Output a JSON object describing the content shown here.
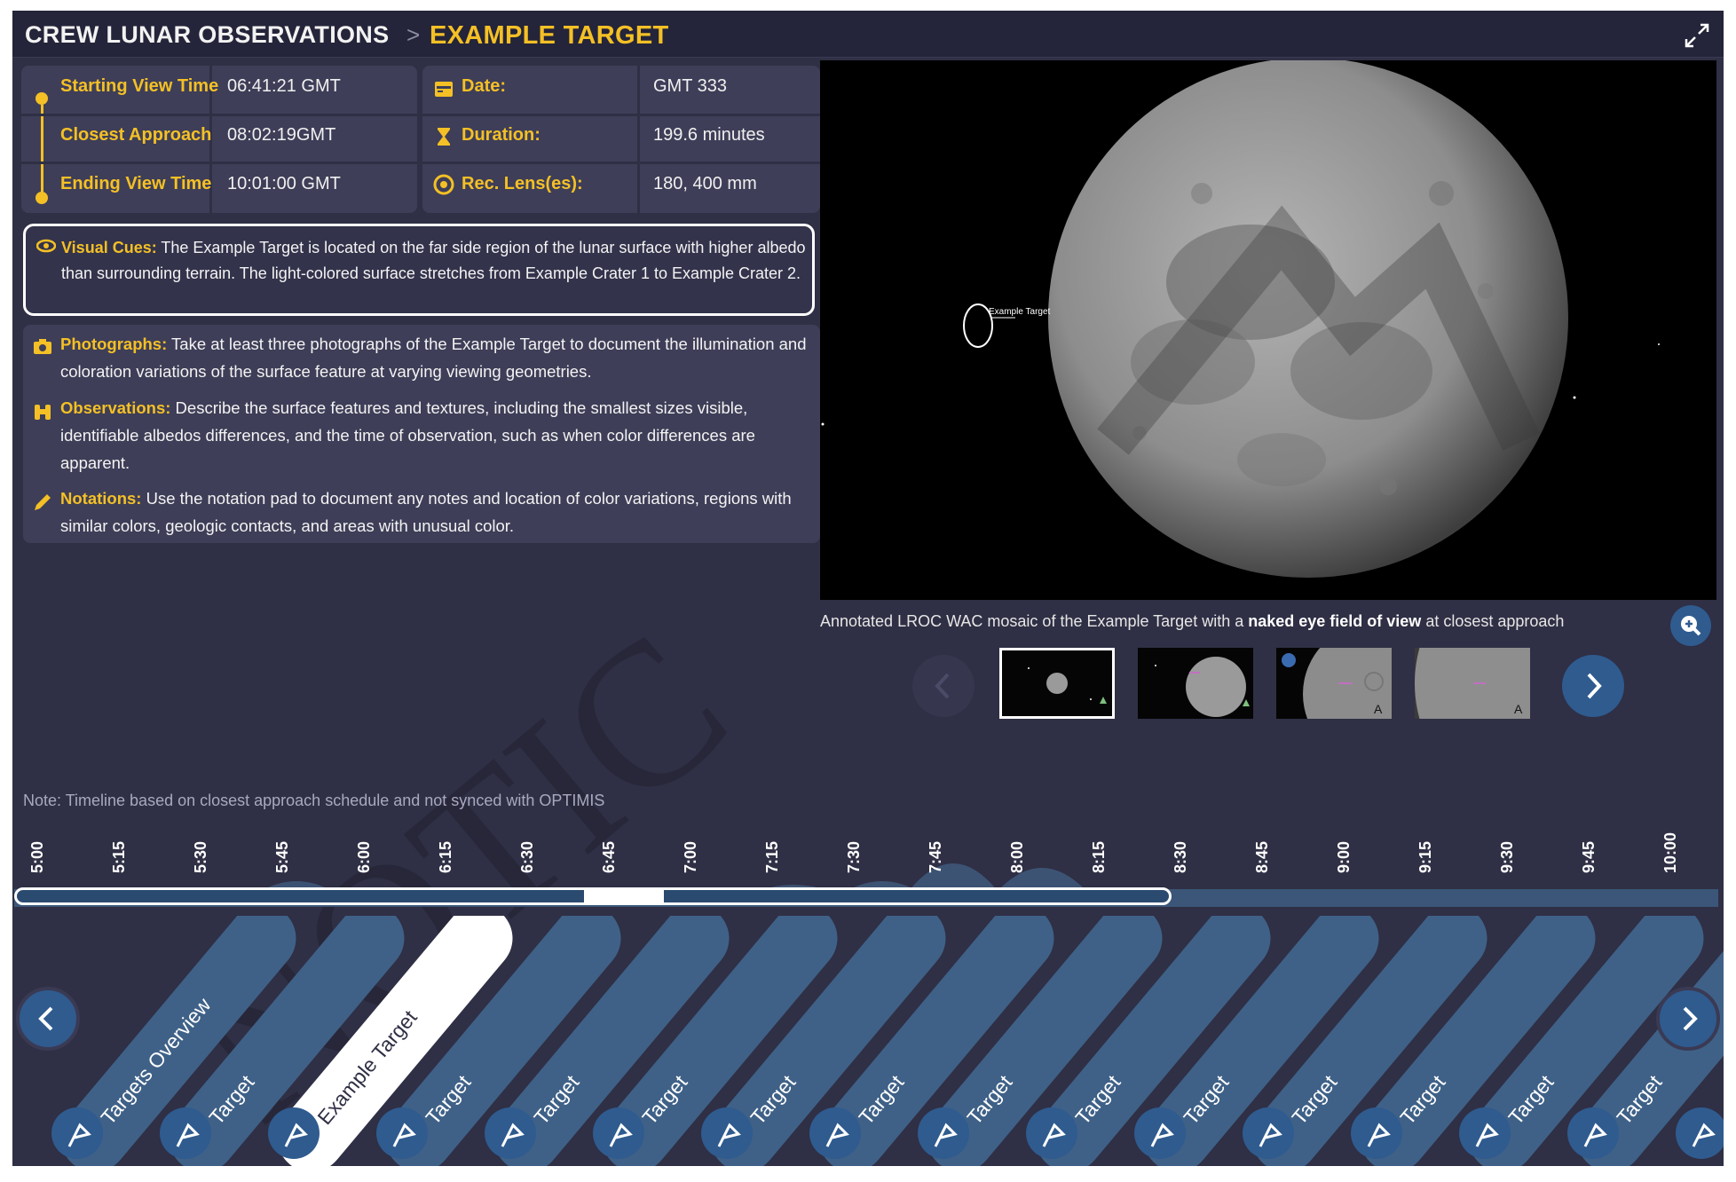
{
  "header": {
    "root": "CREW LUNAR OBSERVATIONS",
    "separator": ">",
    "current": "EXAMPLE TARGET"
  },
  "times": {
    "start_label": "Starting View Time",
    "start_value": "06:41:21 GMT",
    "closest_label": "Closest Approach",
    "closest_value": "08:02:19GMT",
    "end_label": "Ending View Time",
    "end_value": "10:01:00 GMT"
  },
  "meta": {
    "date_label": "Date:",
    "date_value": "GMT 333",
    "duration_label": "Duration:",
    "duration_value": "199.6 minutes",
    "lens_label": "Rec. Lens(es):",
    "lens_value": "180, 400 mm"
  },
  "visual_cues": {
    "label": "Visual Cues:",
    "text": " The Example Target is located on the far side region of the lunar surface with higher albedo than surrounding terrain. The light-colored surface stretches from Example Crater 1 to Example Crater 2."
  },
  "instructions": {
    "photographs_label": "Photographs:",
    "photographs_text": " Take at least three photographs of the Example Target to document the illumination and coloration variations of the surface feature at varying viewing geometries.",
    "observations_label": "Observations:",
    "observations_text": " Describe the surface features and textures, including the smallest sizes visible, identifiable albedos differences, and the time of observation, such as when color differences are apparent.",
    "notations_label": "Notations:",
    "notations_text": " Use the notation pad to document any notes and location of color variations, regions with similar colors, geologic contacts, and areas with unusual color."
  },
  "viewer": {
    "caption_pre": "Annotated LROC WAC mosaic of the Example Target with a ",
    "caption_bold": "naked eye field of view",
    "caption_post": " at closest approach",
    "marker_label": "Example Target"
  },
  "timeline": {
    "note": "Note: Timeline based on closest approach schedule and not synced with OPTIMIS",
    "ticks": [
      "5:00",
      "5:15",
      "5:30",
      "5:45",
      "6:00",
      "6:15",
      "6:30",
      "6:45",
      "7:00",
      "7:15",
      "7:30",
      "7:45",
      "8:00",
      "8:15",
      "8:30",
      "8:45",
      "9:00",
      "9:15",
      "9:30",
      "9:45",
      "10:00"
    ]
  },
  "tabs": [
    "Targets Overview",
    "Target",
    "Example Target",
    "Target",
    "Target",
    "Target",
    "Target",
    "Target",
    "Target",
    "Target",
    "Target",
    "Target",
    "Target",
    "Target",
    "Target"
  ],
  "watermark": "NOTIC",
  "colors": {
    "accent": "#f4c025",
    "background": "#2f2f45",
    "panel": "#3e3e58",
    "tab": "#3f6187",
    "button": "#2f5b8f"
  }
}
